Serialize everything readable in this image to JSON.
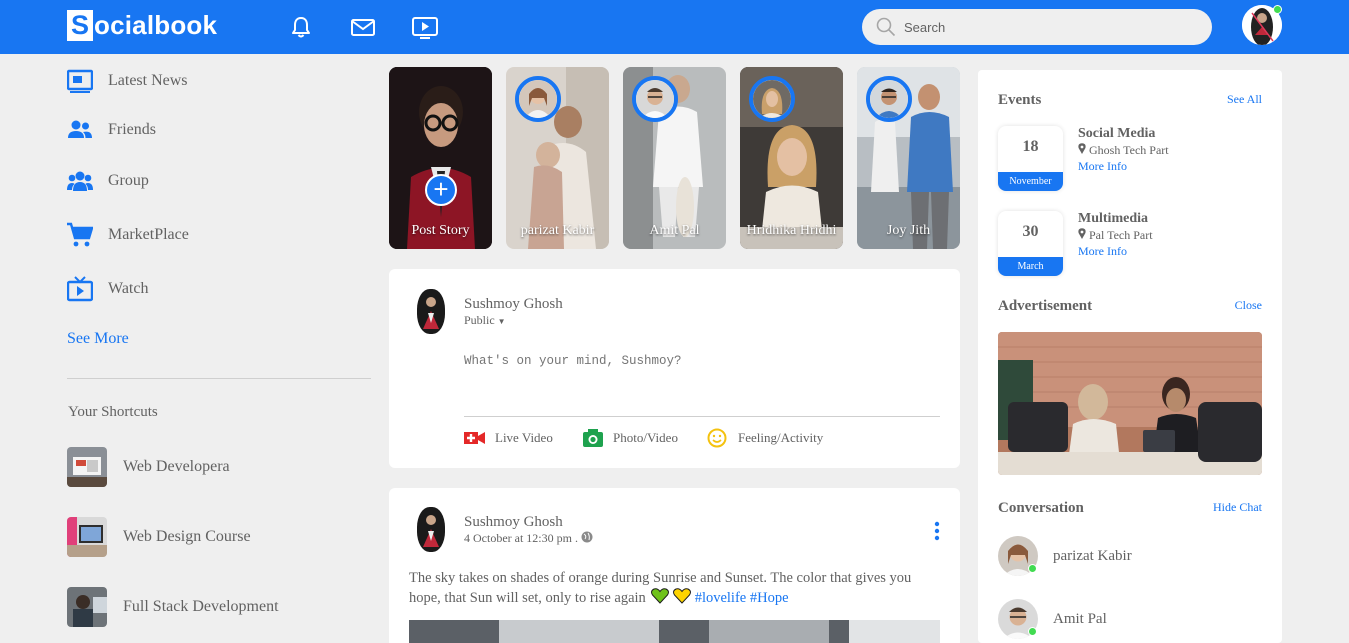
{
  "app": {
    "logo_letter": "S",
    "logo_rest": "ocialbook"
  },
  "navbar": {
    "icons": [
      "bell-icon",
      "mail-icon",
      "video-icon"
    ],
    "search_placeholder": "Search",
    "brand_color": "#1876f2"
  },
  "sidebar": {
    "links": [
      {
        "label": "Latest News",
        "icon": "news-icon"
      },
      {
        "label": "Friends",
        "icon": "friends-icon"
      },
      {
        "label": "Group",
        "icon": "group-icon"
      },
      {
        "label": "MarketPlace",
        "icon": "cart-icon"
      },
      {
        "label": "Watch",
        "icon": "watch-icon"
      }
    ],
    "see_more": "See More",
    "shortcuts_title": "Your Shortcuts",
    "shortcuts": [
      {
        "label": "Web Developera"
      },
      {
        "label": "Web Design Course"
      },
      {
        "label": "Full Stack Development"
      }
    ]
  },
  "stories": [
    {
      "label": "Post Story"
    },
    {
      "label": "parizat Kabir"
    },
    {
      "label": "Amit Pal"
    },
    {
      "label": "Hridhika Hridhi"
    },
    {
      "label": "Joy Jith"
    }
  ],
  "composer": {
    "user": "Sushmoy Ghosh",
    "privacy": "Public",
    "placeholder": "What's on your mind, Sushmoy?",
    "actions": [
      {
        "label": "Live Video",
        "icon": "live-video-icon"
      },
      {
        "label": "Photo/Video",
        "icon": "camera-icon"
      },
      {
        "label": "Feeling/Activity",
        "icon": "smile-icon"
      }
    ]
  },
  "post": {
    "user": "Sushmoy Ghosh",
    "date": "4 October at 12:30 pm .",
    "text": "The sky takes on shades of orange during Sunrise and Sunset. The color that gives you hope, that Sun will set, only to rise again",
    "tag1": "#lovelife",
    "tag2": "#Hope"
  },
  "right": {
    "events_title": "Events",
    "see_all": "See All",
    "events": [
      {
        "day": "18",
        "month": "November",
        "title": "Social Media",
        "place": "Ghosh Tech Part",
        "more": "More Info"
      },
      {
        "day": "30",
        "month": "March",
        "title": "Multimedia",
        "place": "Pal Tech Part",
        "more": "More Info"
      }
    ],
    "ad_title": "Advertisement",
    "close": "Close",
    "conv_title": "Conversation",
    "hide_chat": "Hide Chat",
    "contacts": [
      {
        "name": "parizat Kabir"
      },
      {
        "name": "Amit Pal"
      }
    ]
  }
}
